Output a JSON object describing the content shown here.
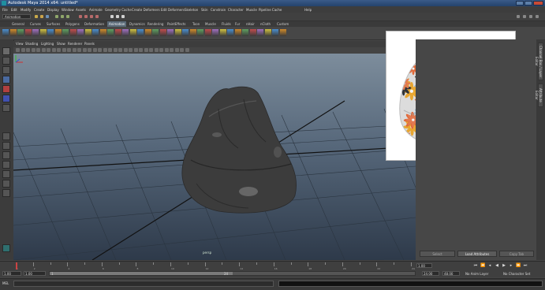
{
  "window": {
    "title": "Autodesk Maya 2014 x64: untitled*",
    "controls": [
      "minimize-icon",
      "maximize-icon",
      "close-icon"
    ]
  },
  "menu": [
    "File",
    "Edit",
    "Modify",
    "Create",
    "Display",
    "Window",
    "Assets",
    "Animate",
    "Geometry Cache",
    "Create Deformers",
    "Edit Deformers",
    "Skeleton",
    "Skin",
    "Constrain",
    "Character",
    "Muscle",
    "Pipeline Cache",
    "Help"
  ],
  "status": {
    "mode": "Animation"
  },
  "shelf_tabs": [
    "General",
    "Curves",
    "Surfaces",
    "Polygons",
    "Deformation",
    "Animation",
    "Dynamics",
    "Rendering",
    "PaintEffects",
    "Toon",
    "Muscle",
    "Fluids",
    "Fur",
    "nHair",
    "nCloth",
    "Custom"
  ],
  "active_shelf_tab": "Animation",
  "panel_menu": [
    "View",
    "Shading",
    "Lighting",
    "Show",
    "Renderer",
    "Panels"
  ],
  "viewport": {
    "camera": "persp"
  },
  "right_panel": {
    "buttons": [
      "Select",
      "Load Attributes",
      "Copy Tab"
    ],
    "side_tabs": [
      "Channel Box / Layer Editor",
      "Attribute Editor"
    ]
  },
  "timeline": {
    "tick_labels": [
      "1",
      "2",
      "4",
      "6",
      "8",
      "10",
      "12",
      "14",
      "16",
      "18",
      "20",
      "22",
      "24"
    ],
    "current_frame": "1.00"
  },
  "range": {
    "start": "1.00",
    "playback_start": "1.00",
    "slider_value": "1",
    "slider_end_label": "24",
    "playback_end": "24.00",
    "end": "48.00",
    "anim_layer": "No Anim Layer",
    "char_set": "No Character Set"
  },
  "command_line": {
    "label": "MEL"
  },
  "colors": {
    "accent": "#5a6a78",
    "viewport_top": "#7d8d9c",
    "viewport_bottom": "#2e3a4a",
    "beanbag": "#3c3c3c"
  }
}
